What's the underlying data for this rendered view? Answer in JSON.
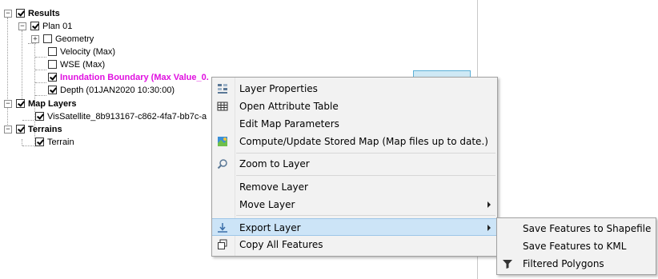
{
  "tree": {
    "results": "Results",
    "plan": "Plan 01",
    "geometry": "Geometry",
    "velocity": "Velocity (Max)",
    "wse": "WSE (Max)",
    "inundation": "Inundation Boundary (Max Value_0.",
    "depth": "Depth (01JAN2020 10:30:00)",
    "map_layers": "Map Layers",
    "vis_satellite": "VisSatellite_8b913167-c862-4fa7-bb7c-a",
    "terrains": "Terrains",
    "terrain": "Terrain"
  },
  "context_menu": {
    "items": [
      {
        "label": "Layer Properties",
        "icon": "layer-properties-icon"
      },
      {
        "label": "Open Attribute Table",
        "icon": "table-icon"
      },
      {
        "label": "Edit Map Parameters",
        "icon": ""
      },
      {
        "label": "Compute/Update Stored Map (Map files up to date.)",
        "icon": "compute-map-icon"
      },
      {
        "label": "Zoom to Layer",
        "icon": "zoom-icon"
      },
      {
        "label": "Remove Layer",
        "icon": ""
      },
      {
        "label": "Move Layer",
        "icon": ""
      },
      {
        "label": "Export Layer",
        "icon": "export-icon"
      },
      {
        "label": "Copy All Features",
        "icon": "copy-icon"
      }
    ]
  },
  "submenu": {
    "items": [
      {
        "label": "Save Features to Shapefile"
      },
      {
        "label": "Save Features to KML"
      },
      {
        "label": "Filtered Polygons",
        "icon": "filter-icon"
      }
    ]
  },
  "colors": {
    "inundation_text": "#e010e0",
    "highlight": "#cce4f7",
    "menu_bg": "#f2f2f2"
  }
}
